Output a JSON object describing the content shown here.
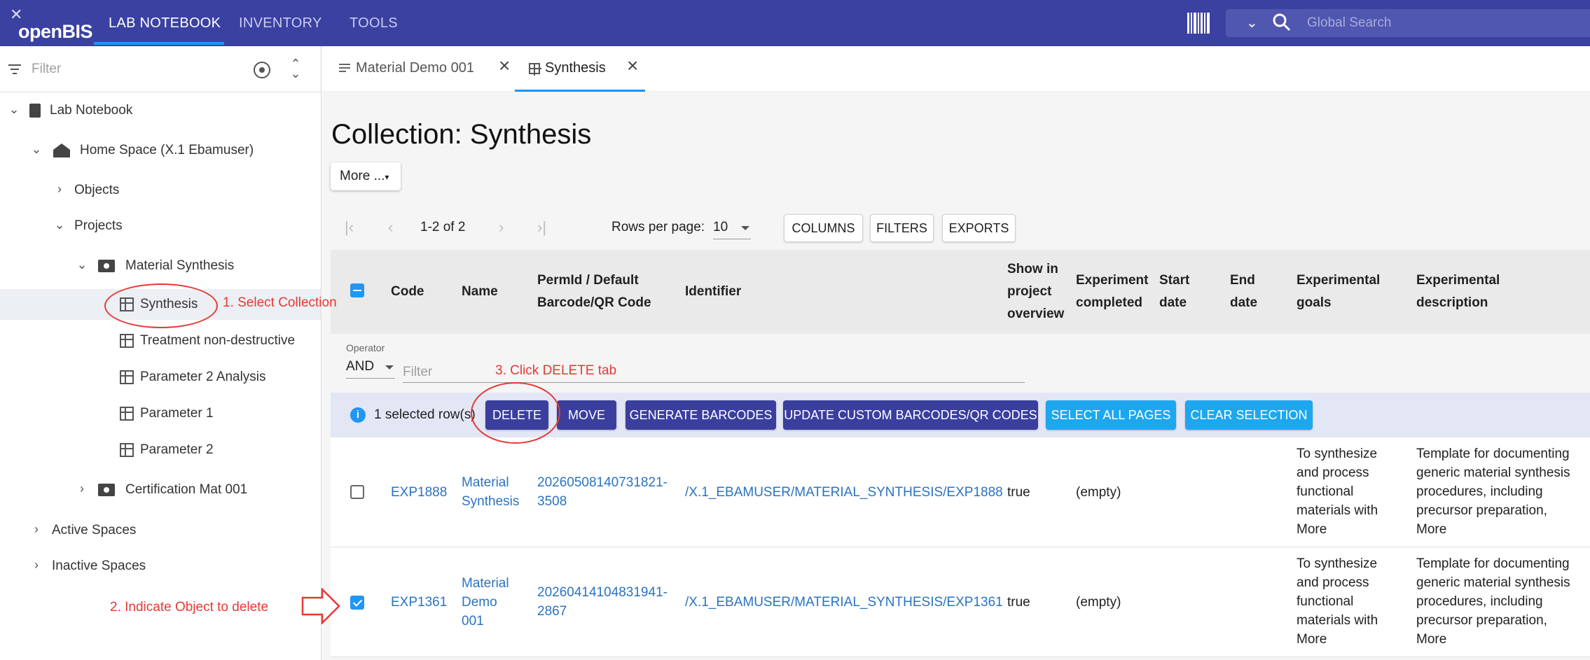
{
  "app": {
    "logo_text": "openBIS",
    "nav_tabs": [
      "LAB NOTEBOOK",
      "INVENTORY",
      "TOOLS"
    ],
    "search_placeholder": "Global Search"
  },
  "sidebar": {
    "filter_placeholder": "Filter",
    "tree": {
      "lab_notebook": "Lab Notebook",
      "home_space": "Home Space (X.1 Ebamuser)",
      "objects": "Objects",
      "projects": "Projects",
      "material_synthesis": "Material Synthesis",
      "synthesis": "Synthesis",
      "treatment": "Treatment non-destructive",
      "param2_analysis": "Parameter 2 Analysis",
      "param1": "Parameter 1",
      "param2": "Parameter 2",
      "certification": "Certification Mat 001",
      "active_spaces": "Active Spaces",
      "inactive_spaces": "Inactive Spaces"
    }
  },
  "annotations": {
    "step1": "1. Select Collection",
    "step2": "2. Indicate Object to delete",
    "step3": "3. Click DELETE tab"
  },
  "tabs": [
    {
      "label": "Material Demo 001"
    },
    {
      "label": "Synthesis"
    }
  ],
  "page": {
    "title": "Collection: Synthesis",
    "more_label": "More ..."
  },
  "pager": {
    "range": "1-2 of 2",
    "rows_label": "Rows per page:",
    "rows_value": "10",
    "columns": "COLUMNS",
    "filters": "FILTERS",
    "exports": "EXPORTS"
  },
  "table": {
    "headers": {
      "code": "Code",
      "name": "Name",
      "permid_1": "PermId / Default",
      "permid_2": "Barcode/QR Code",
      "identifier": "Identifier",
      "show_1": "Show in",
      "show_2": "project",
      "show_3": "overview",
      "completed_1": "Experiment",
      "completed_2": "completed",
      "start_1": "Start",
      "start_2": "date",
      "end_1": "End",
      "end_2": "date",
      "goals_1": "Experimental",
      "goals_2": "goals",
      "desc_1": "Experimental",
      "desc_2": "description"
    },
    "operator_label": "Operator",
    "operator_value": "AND",
    "filter_placeholder": "Filter",
    "selection": {
      "text": "1 selected row(s)",
      "delete": "DELETE",
      "move": "MOVE",
      "generate": "GENERATE BARCODES",
      "update": "UPDATE CUSTOM BARCODES/QR CODES",
      "select_all": "SELECT ALL PAGES",
      "clear": "CLEAR SELECTION"
    },
    "rows": [
      {
        "code": "EXP1888",
        "name_1": "Material",
        "name_2": "Synthesis",
        "permid_1": "20260508140731821-",
        "permid_2": "3508",
        "identifier": "/X.1_EBAMUSER/MATERIAL_SYNTHESIS/EXP1888",
        "show": "true",
        "completed": "(empty)",
        "goals_1": "To synthesize",
        "goals_2": "and process",
        "goals_3": "functional",
        "goals_4": "materials with",
        "desc_1": "Template for documenting",
        "desc_2": "generic material synthesis",
        "desc_3": "procedures, including",
        "desc_4": "precursor preparation,",
        "more": "More",
        "checked": false
      },
      {
        "code": "EXP1361",
        "name_1": "Material",
        "name_2": "Demo",
        "name_3": "001",
        "permid_1": "20260414104831941-",
        "permid_2": "2867",
        "identifier": "/X.1_EBAMUSER/MATERIAL_SYNTHESIS/EXP1361",
        "show": "true",
        "completed": "(empty)",
        "goals_1": "To synthesize",
        "goals_2": "and process",
        "goals_3": "functional",
        "goals_4": "materials with",
        "desc_1": "Template for documenting",
        "desc_2": "generic material synthesis",
        "desc_3": "procedures, including",
        "desc_4": "precursor preparation,",
        "more": "More",
        "checked": true
      }
    ]
  },
  "colors": {
    "appbar": "#3a41a0",
    "accent": "#2196f3",
    "dark_button": "#3a3f9e",
    "light_button": "#1ea7ef",
    "annotation": "#e53935",
    "link": "#2a73c2"
  }
}
